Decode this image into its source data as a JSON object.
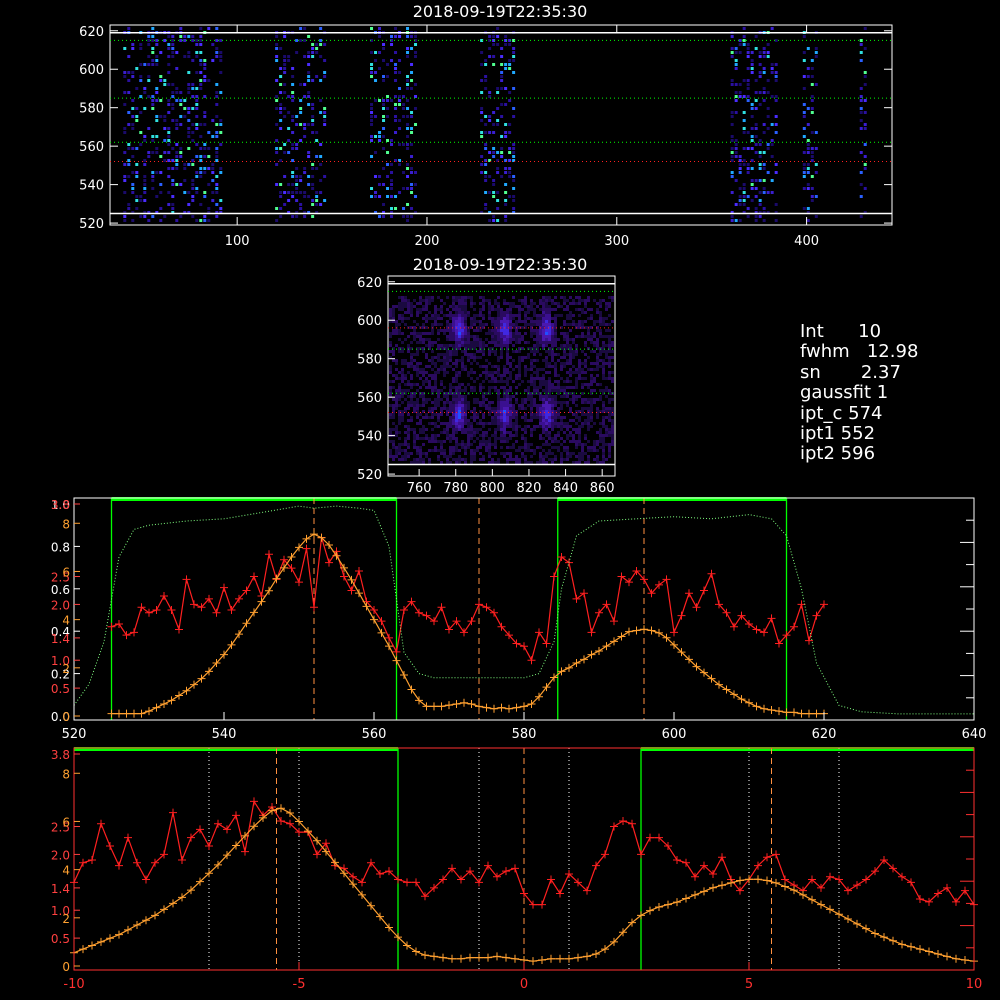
{
  "info": [
    {
      "key": "Int",
      "value": "10"
    },
    {
      "key": "fwhm",
      "value": "12.98"
    },
    {
      "key": "sn",
      "value": "2.37"
    },
    {
      "key": "gaussfit",
      "value": "1"
    },
    {
      "key": "ipt_c",
      "value": "574"
    },
    {
      "key": "ipt1",
      "value": "552"
    },
    {
      "key": "ipt2",
      "value": "596"
    }
  ],
  "colors": {
    "background": "#000000",
    "axes": "#ffffff",
    "red_series": "#ff2020",
    "orange_series": "#ffa030",
    "green": "#00ff00",
    "red_axis_text": "#ff4040",
    "orange_dash": "#ff9040"
  },
  "chart_data": [
    {
      "type": "heatmap",
      "title": "2018-09-19T22:35:30",
      "xlim": [
        33,
        445
      ],
      "ylim": [
        519,
        623
      ],
      "xticks": [
        "100",
        "200",
        "300",
        "400"
      ],
      "yticks": [
        "520",
        "540",
        "560",
        "580",
        "600",
        "620"
      ],
      "white_lines_y": [
        619,
        525
      ],
      "green_dotted_y": [
        615,
        585,
        562
      ],
      "red_dotted_y": [
        552
      ],
      "data_bands_x": [
        [
          40,
          92
        ],
        [
          120,
          147
        ],
        [
          170,
          195
        ],
        [
          228,
          245
        ],
        [
          360,
          385
        ],
        [
          398,
          406
        ],
        [
          428,
          432
        ]
      ]
    },
    {
      "type": "heatmap",
      "title": "2018-09-19T22:35:30",
      "xlim": [
        743,
        867
      ],
      "ylim": [
        519,
        623
      ],
      "xticks": [
        "760",
        "780",
        "800",
        "820",
        "840",
        "860"
      ],
      "yticks": [
        "520",
        "540",
        "560",
        "580",
        "600",
        "620"
      ],
      "white_lines_y": [
        619,
        525
      ],
      "green_dotted_y": [
        615,
        585,
        562
      ],
      "red_dotted_y": [
        552,
        596
      ],
      "bright_spots": [
        {
          "x": 781,
          "y": 596
        },
        {
          "x": 806,
          "y": 596
        },
        {
          "x": 829,
          "y": 596
        },
        {
          "x": 781,
          "y": 552
        },
        {
          "x": 806,
          "y": 552
        },
        {
          "x": 829,
          "y": 552
        }
      ]
    },
    {
      "type": "line",
      "xlim": [
        520,
        640
      ],
      "xticks": [
        "520",
        "540",
        "560",
        "580",
        "600",
        "620",
        "640"
      ],
      "left_axis_labels_white": [
        "0.0",
        "0.2",
        "0.4",
        "0.6",
        "0.8",
        "1.0"
      ],
      "left_axis_labels_red": [
        "0.5",
        "1.0",
        "1.4",
        "2.0",
        "2.5",
        "3.8"
      ],
      "left_axis_labels_orange": [
        "0",
        "2",
        "4",
        "6",
        "8"
      ],
      "green_boxes": [
        [
          525,
          563
        ],
        [
          584.5,
          615
        ]
      ],
      "red_dashed_x": [
        552,
        596
      ],
      "orange_dashed_x": [
        574
      ],
      "series": [
        {
          "name": "red",
          "x": [
            525,
            526,
            527,
            528,
            529,
            530,
            531,
            532,
            533,
            534,
            535,
            536,
            537,
            538,
            539,
            540,
            541,
            542,
            543,
            544,
            545,
            546,
            547,
            548,
            549,
            550,
            551,
            552,
            553,
            554,
            555,
            556,
            557,
            558,
            559,
            560,
            561,
            562,
            563,
            564,
            565,
            566,
            567,
            568,
            569,
            570,
            571,
            572,
            573,
            574,
            575,
            576,
            577,
            578,
            579,
            580,
            581,
            582,
            583,
            584,
            585,
            586,
            587,
            588,
            589,
            590,
            591,
            592,
            593,
            594,
            595,
            596,
            597,
            598,
            599,
            600,
            601,
            602,
            603,
            604,
            605,
            606,
            607,
            608,
            609,
            610,
            611,
            612,
            613,
            614,
            615,
            616,
            617,
            618,
            619,
            620
          ],
          "y": [
            1.6,
            1.65,
            1.45,
            1.5,
            1.95,
            1.85,
            1.9,
            2.15,
            1.9,
            1.55,
            2.45,
            2.0,
            1.95,
            2.1,
            1.85,
            2.3,
            1.9,
            2.1,
            2.25,
            2.5,
            2.15,
            2.9,
            2.45,
            2.8,
            2.65,
            2.4,
            3.0,
            1.95,
            3.2,
            2.75,
            2.95,
            2.5,
            2.25,
            2.6,
            2.05,
            1.9,
            1.7,
            1.4,
            1.15,
            1.9,
            2.05,
            1.85,
            1.8,
            1.7,
            1.95,
            1.55,
            1.7,
            1.5,
            1.7,
            2.0,
            1.95,
            1.85,
            1.6,
            1.45,
            1.3,
            1.25,
            1.0,
            1.5,
            1.3,
            2.5,
            2.85,
            2.75,
            2.1,
            2.2,
            1.5,
            1.85,
            2.0,
            1.7,
            2.5,
            2.4,
            2.6,
            2.45,
            2.2,
            2.35,
            2.45,
            1.5,
            1.8,
            2.2,
            1.95,
            2.25,
            2.55,
            2.0,
            1.85,
            1.6,
            1.8,
            1.65,
            1.55,
            1.5,
            1.75,
            1.3,
            1.45,
            1.6,
            2.0,
            1.35,
            1.8,
            2.0
          ],
          "ymax": 3.8
        },
        {
          "name": "orange",
          "x": [
            525,
            526,
            527,
            528,
            529,
            530,
            531,
            532,
            533,
            534,
            535,
            536,
            537,
            538,
            539,
            540,
            541,
            542,
            543,
            544,
            545,
            546,
            547,
            548,
            549,
            550,
            551,
            552,
            553,
            554,
            555,
            556,
            557,
            558,
            559,
            560,
            561,
            562,
            563,
            564,
            565,
            566,
            567,
            568,
            569,
            570,
            571,
            572,
            573,
            574,
            575,
            576,
            577,
            578,
            579,
            580,
            581,
            582,
            583,
            584,
            585,
            586,
            587,
            588,
            589,
            590,
            591,
            592,
            593,
            594,
            595,
            596,
            597,
            598,
            599,
            600,
            601,
            602,
            603,
            604,
            605,
            606,
            607,
            608,
            609,
            610,
            611,
            612,
            613,
            614,
            615,
            616,
            617,
            618,
            619,
            620
          ],
          "y": [
            0.1,
            0.1,
            0.1,
            0.1,
            0.1,
            0.2,
            0.35,
            0.5,
            0.65,
            0.85,
            1.05,
            1.3,
            1.55,
            1.85,
            2.2,
            2.55,
            2.95,
            3.4,
            3.85,
            4.3,
            4.75,
            5.2,
            5.7,
            6.15,
            6.6,
            7.0,
            7.35,
            7.55,
            7.4,
            7.1,
            6.65,
            6.15,
            5.65,
            5.1,
            4.55,
            4.0,
            3.45,
            2.9,
            2.3,
            1.7,
            1.1,
            0.65,
            0.4,
            0.4,
            0.4,
            0.45,
            0.5,
            0.55,
            0.5,
            0.4,
            0.35,
            0.3,
            0.35,
            0.3,
            0.35,
            0.4,
            0.5,
            0.8,
            1.2,
            1.6,
            1.85,
            2.0,
            2.2,
            2.35,
            2.55,
            2.7,
            2.9,
            3.1,
            3.3,
            3.5,
            3.55,
            3.6,
            3.55,
            3.45,
            3.25,
            2.95,
            2.65,
            2.35,
            2.05,
            1.8,
            1.55,
            1.3,
            1.1,
            0.9,
            0.7,
            0.55,
            0.4,
            0.3,
            0.25,
            0.2,
            0.15,
            0.15,
            0.1,
            0.1,
            0.1,
            0.1
          ],
          "ymax": 8.8
        },
        {
          "name": "green",
          "x": [
            520,
            522,
            524,
            526,
            528,
            530,
            535,
            540,
            545,
            550,
            552,
            555,
            558,
            560,
            562,
            563,
            564,
            566,
            568,
            570,
            575,
            580,
            582,
            584,
            585,
            587,
            590,
            595,
            600,
            605,
            610,
            613,
            615,
            617,
            619,
            622,
            625,
            630,
            635,
            640
          ],
          "y": [
            0.05,
            0.15,
            0.35,
            0.75,
            0.88,
            0.9,
            0.92,
            0.93,
            0.96,
            0.99,
            0.98,
            0.99,
            0.98,
            0.97,
            0.8,
            0.55,
            0.3,
            0.2,
            0.18,
            0.18,
            0.18,
            0.18,
            0.2,
            0.35,
            0.6,
            0.85,
            0.92,
            0.93,
            0.94,
            0.93,
            0.95,
            0.93,
            0.85,
            0.6,
            0.25,
            0.05,
            0.02,
            0.01,
            0.01,
            0.01
          ],
          "ymax": 1.0
        }
      ]
    },
    {
      "type": "line",
      "xlim": [
        -10,
        10
      ],
      "xticks": [
        "-10",
        "-5",
        "0",
        "5",
        "10"
      ],
      "left_axis_labels_red": [
        "0.5",
        "1.0",
        "1.4",
        "2.0",
        "2.5",
        "3.8"
      ],
      "left_axis_labels_orange": [
        "0",
        "2",
        "4",
        "6",
        "8"
      ],
      "green_boxes": [
        [
          -12,
          -2.8
        ],
        [
          2.6,
          12
        ]
      ],
      "orange_dashed_x": [
        -5.5,
        0,
        5.5
      ],
      "white_dotted_x": [
        -7,
        -5,
        -1,
        1,
        5,
        7
      ],
      "series": [
        {
          "name": "red",
          "x": [
            -10,
            -9.8,
            -9.6,
            -9.4,
            -9.2,
            -9.0,
            -8.8,
            -8.6,
            -8.4,
            -8.2,
            -8.0,
            -7.8,
            -7.6,
            -7.4,
            -7.2,
            -7.0,
            -6.8,
            -6.6,
            -6.4,
            -6.2,
            -6.0,
            -5.8,
            -5.6,
            -5.4,
            -5.2,
            -5.0,
            -4.8,
            -4.6,
            -4.4,
            -4.2,
            -4.0,
            -3.8,
            -3.6,
            -3.4,
            -3.2,
            -3.0,
            -2.8,
            -2.6,
            -2.4,
            -2.2,
            -2.0,
            -1.8,
            -1.6,
            -1.4,
            -1.2,
            -1.0,
            -0.8,
            -0.6,
            -0.4,
            -0.2,
            0,
            0.2,
            0.4,
            0.6,
            0.8,
            1.0,
            1.2,
            1.4,
            1.6,
            1.8,
            2.0,
            2.2,
            2.4,
            2.6,
            2.8,
            3.0,
            3.2,
            3.4,
            3.6,
            3.8,
            4.0,
            4.2,
            4.4,
            4.6,
            4.8,
            5.0,
            5.2,
            5.4,
            5.6,
            5.8,
            6.0,
            6.2,
            6.4,
            6.6,
            6.8,
            7.0,
            7.2,
            7.4,
            7.6,
            7.8,
            8.0,
            8.2,
            8.4,
            8.6,
            8.8,
            9.0,
            9.2,
            9.4,
            9.6,
            9.8,
            10.0
          ],
          "y": [
            1.5,
            1.85,
            1.9,
            2.55,
            2.15,
            1.8,
            2.3,
            1.85,
            1.55,
            1.85,
            2.0,
            2.75,
            1.9,
            2.3,
            2.45,
            2.15,
            2.55,
            2.45,
            2.7,
            2.05,
            2.95,
            2.7,
            2.85,
            2.6,
            2.55,
            2.4,
            2.4,
            2.0,
            2.2,
            1.8,
            1.75,
            1.6,
            1.5,
            1.85,
            1.65,
            1.7,
            1.55,
            1.5,
            1.5,
            1.25,
            1.4,
            1.55,
            1.75,
            1.55,
            1.7,
            1.5,
            1.8,
            1.6,
            1.7,
            1.75,
            1.3,
            1.1,
            1.1,
            1.55,
            1.3,
            1.65,
            1.5,
            1.35,
            1.8,
            2.0,
            2.5,
            2.6,
            2.55,
            2.0,
            2.3,
            2.3,
            2.15,
            1.9,
            1.85,
            1.6,
            1.8,
            1.65,
            1.95,
            1.55,
            1.35,
            1.55,
            1.8,
            1.95,
            2.0,
            1.55,
            1.45,
            1.35,
            1.55,
            1.4,
            1.6,
            1.55,
            1.35,
            1.45,
            1.55,
            1.7,
            1.9,
            1.75,
            1.6,
            1.5,
            1.2,
            1.15,
            1.3,
            1.4,
            1.15,
            1.35,
            1.1
          ],
          "ymax": 3.8
        },
        {
          "name": "orange",
          "x": [
            -10,
            -9.8,
            -9.6,
            -9.4,
            -9.2,
            -9.0,
            -8.8,
            -8.6,
            -8.4,
            -8.2,
            -8.0,
            -7.8,
            -7.6,
            -7.4,
            -7.2,
            -7.0,
            -6.8,
            -6.6,
            -6.4,
            -6.2,
            -6.0,
            -5.8,
            -5.6,
            -5.4,
            -5.2,
            -5.0,
            -4.8,
            -4.6,
            -4.4,
            -4.2,
            -4.0,
            -3.8,
            -3.6,
            -3.4,
            -3.2,
            -3.0,
            -2.8,
            -2.6,
            -2.4,
            -2.2,
            -2.0,
            -1.8,
            -1.6,
            -1.4,
            -1.2,
            -1.0,
            -0.8,
            -0.6,
            -0.4,
            -0.2,
            0,
            0.2,
            0.4,
            0.6,
            0.8,
            1.0,
            1.2,
            1.4,
            1.6,
            1.8,
            2.0,
            2.2,
            2.4,
            2.6,
            2.8,
            3.0,
            3.2,
            3.4,
            3.6,
            3.8,
            4.0,
            4.2,
            4.4,
            4.6,
            4.8,
            5.0,
            5.2,
            5.4,
            5.6,
            5.8,
            6.0,
            6.2,
            6.4,
            6.6,
            6.8,
            7.0,
            7.2,
            7.4,
            7.6,
            7.8,
            8.0,
            8.2,
            8.4,
            8.6,
            8.8,
            9.0,
            9.2,
            9.4,
            9.6,
            9.8,
            10.0
          ],
          "y": [
            0.55,
            0.7,
            0.85,
            1.0,
            1.15,
            1.3,
            1.5,
            1.7,
            1.9,
            2.1,
            2.35,
            2.6,
            2.85,
            3.15,
            3.5,
            3.85,
            4.2,
            4.6,
            5.0,
            5.4,
            5.8,
            6.15,
            6.45,
            6.55,
            6.35,
            6.0,
            5.6,
            5.2,
            4.75,
            4.3,
            3.85,
            3.4,
            2.95,
            2.5,
            2.05,
            1.6,
            1.2,
            0.85,
            0.6,
            0.45,
            0.4,
            0.35,
            0.3,
            0.3,
            0.35,
            0.35,
            0.35,
            0.4,
            0.35,
            0.3,
            0.25,
            0.2,
            0.25,
            0.3,
            0.3,
            0.3,
            0.35,
            0.4,
            0.5,
            0.7,
            1.0,
            1.4,
            1.8,
            2.1,
            2.3,
            2.45,
            2.55,
            2.65,
            2.8,
            2.95,
            3.1,
            3.25,
            3.35,
            3.45,
            3.55,
            3.6,
            3.6,
            3.55,
            3.45,
            3.3,
            3.15,
            2.95,
            2.75,
            2.55,
            2.35,
            2.15,
            1.95,
            1.75,
            1.55,
            1.35,
            1.2,
            1.05,
            0.9,
            0.8,
            0.7,
            0.6,
            0.5,
            0.4,
            0.3,
            0.25,
            0.2
          ],
          "ymax": 8.8
        }
      ]
    }
  ]
}
